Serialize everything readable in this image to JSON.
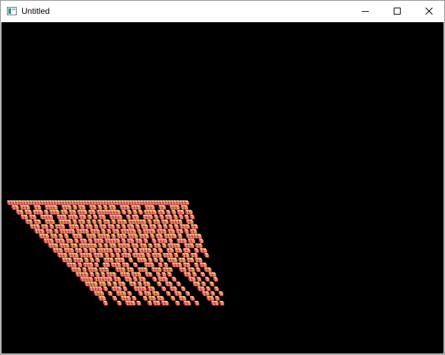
{
  "window": {
    "title": "Untitled",
    "controls": {
      "minimize_icon": "minimize-icon",
      "maximize_icon": "maximize-icon",
      "close_icon": "close-icon"
    }
  },
  "canvas": {
    "background": "#000000",
    "colors": {
      "top": "#f6d37a",
      "front": "#e49268",
      "side": "#c8435e",
      "edge": "#d0304e"
    },
    "rows": [
      "11111111111111111111111111111111111111111111111111111111111111111",
      "01101110011001111001110101100110101011001110111001110011001110110",
      "00110110111010111011011011101101111111101010101011110110101011011",
      "00011011001111001110111011010101100111100101100111010101101010101",
      "00001101100111001111010110101010110101110111111010110110111100110",
      "00000111011010111001110101101011011010101101011011010101010111011",
      "00000011101101011111011110111010101101111101011110111011011010110",
      "00000001110110101001110011101111010111011101110101101111010011111",
      "00000000111011101101011010111011111010110110100101110100111011001",
      "00000000011101110110111111010101101111011011010110101111001110110",
      "00000000001110111011010110111110110101010111101010011011011001011",
      "00000000000111011101111011101010101110111101011101110100110110001",
      "00000000000011101110101010011101110010011101010100111011011011000",
      "00000000000001110101110100110111011001000111001010011101100101100",
      "00000000000000111010111011100011101100111001110111000110110100110",
      "00000000000000011110101010111001110111001100101010000011010010011",
      "00000000000000001111011111101100110101100010111001000001101001001",
      "00000000000000000111101101010110011010110001001100100000110100100",
      "00000000000000000011110100111010001111011000100110010000011010010",
      "00000000000000000001110010011101000101101100010011001000001101001",
      "00000000000000000000110001001110100010110110001001100100000110100",
      "00000000000000000000010000100111010001011011000100110010000011010"
    ]
  }
}
